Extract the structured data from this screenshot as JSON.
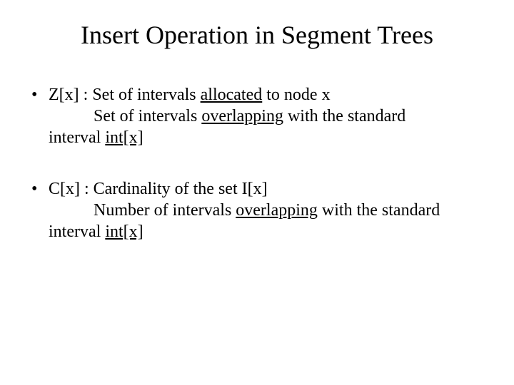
{
  "title": "Insert Operation in Segment Trees",
  "bullets": [
    {
      "lead": "Z[x] : Set of intervals ",
      "u1": "allocated",
      "tail1": " to node x",
      "line2a": "Set of intervals ",
      "u2": "overlapping",
      "line2b": " with the standard",
      "line3a": "interval ",
      "u3": "int[x]"
    },
    {
      "lead": "C[x] : Cardinality of the set I[x]",
      "line2a": "Number of intervals ",
      "u2": "overlapping",
      "line2b": " with the standard",
      "line3a": "interval ",
      "u3": "int[x]"
    }
  ]
}
